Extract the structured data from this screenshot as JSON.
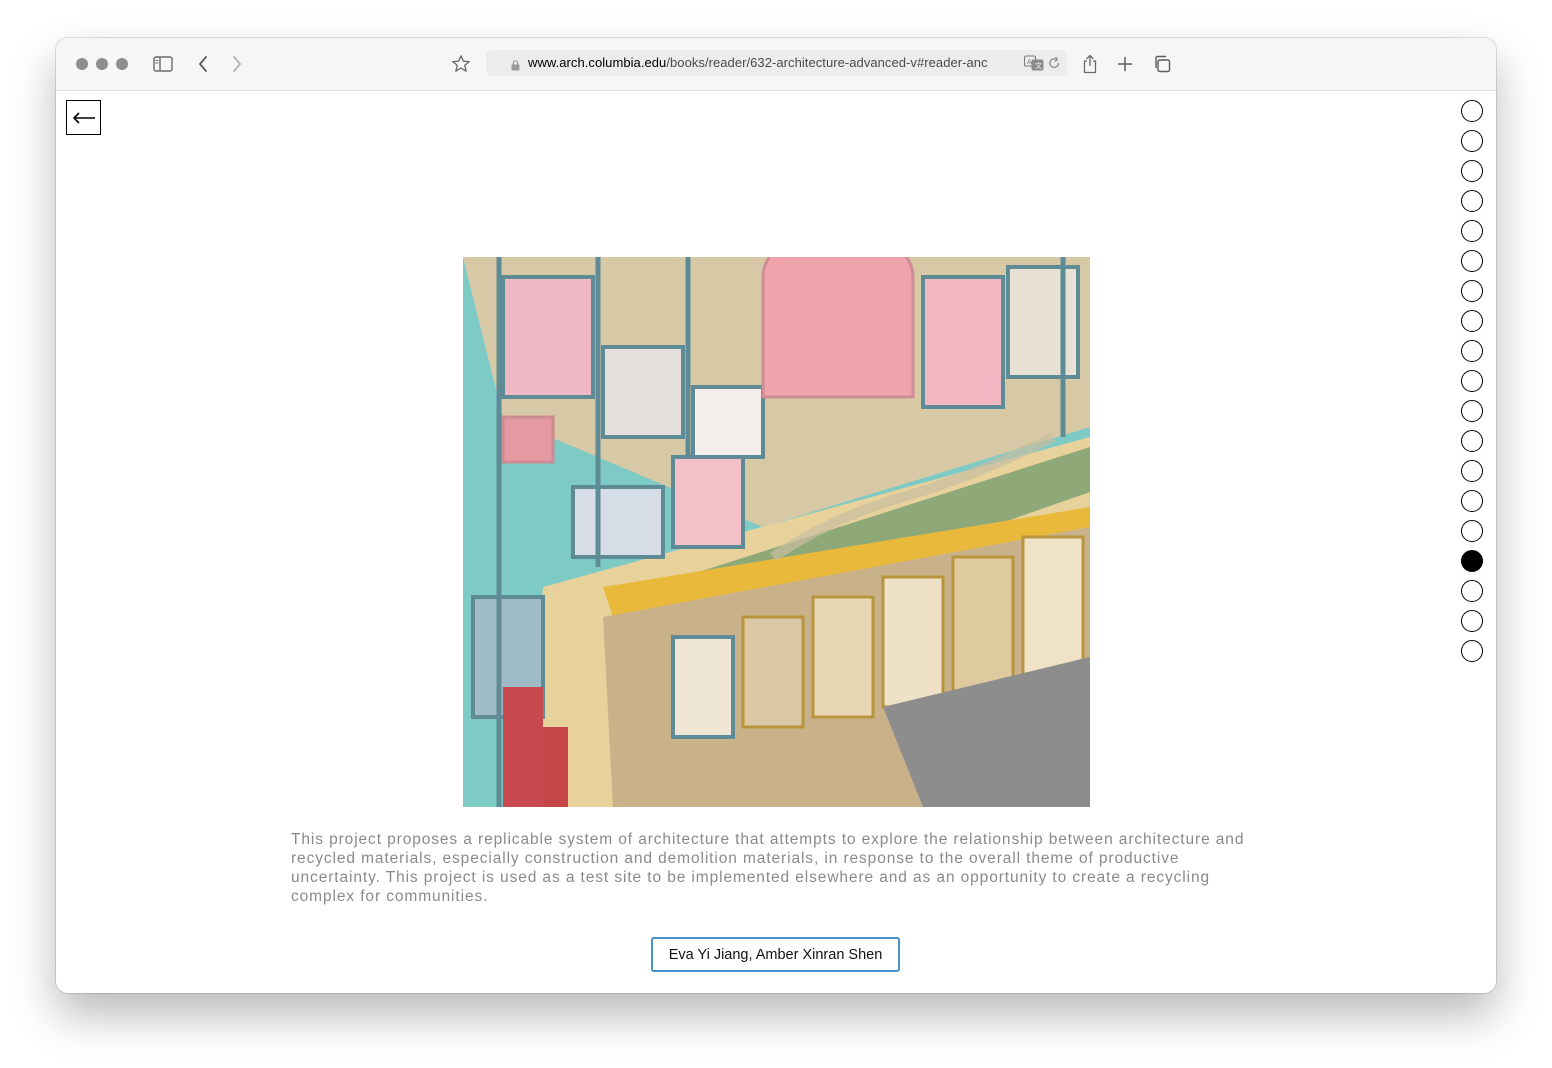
{
  "browser": {
    "url_domain": "www.arch.columbia.edu",
    "url_path": "/books/reader/632-architecture-advanced-v#reader-anc"
  },
  "toolbar_icons": [
    "sidebar-icon",
    "back-icon",
    "forward-icon",
    "bookmark-star-icon",
    "lock-icon",
    "translate-icon",
    "reload-icon",
    "share-icon",
    "new-tab-icon",
    "tab-overview-icon"
  ],
  "page": {
    "back_arrow": "←",
    "caption": "This project proposes a replicable system of architecture that attempts to explore the relationship between architecture and recycled materials, especially construction and demolition materials, in response to the overall theme of productive uncertainty. This project is used as a test site to be implemented elsewhere and as an opportunity to create a recycling complex for communities.",
    "authors": "Eva Yi Jiang, Amber Xinran Shen"
  },
  "pagination": {
    "total": 19,
    "current": 16
  },
  "colors": {
    "accent_border": "#4a90c9",
    "caption_text": "#8a8a8a",
    "active_dot": "#000000"
  }
}
